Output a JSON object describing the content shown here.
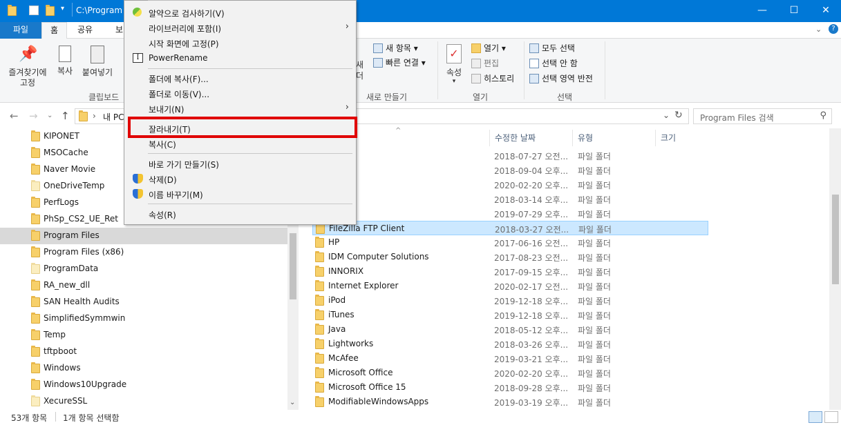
{
  "window": {
    "path": "C:\\Program"
  },
  "tabs": [
    "파일",
    "홈",
    "공유",
    "보"
  ],
  "ribbon": {
    "pin_label": "즐겨찾기에\n고정",
    "copy_label": "복사",
    "paste_label": "붙여넣기",
    "clipboard_group": "클립보드",
    "new_item": "새 항목",
    "easy_access": "빠른 연결",
    "new_group": "새로 만들기",
    "new_folder_partial": "새\n더",
    "properties": "속성",
    "open": "열기",
    "edit": "편집",
    "history": "히스토리",
    "open_group": "열기",
    "select_all": "모두 선택",
    "select_none": "선택 안 함",
    "invert_selection": "선택 영역 반전",
    "select_group": "선택"
  },
  "address": {
    "partial": "내 PC",
    "search_placeholder": "Program Files 검색"
  },
  "columns": {
    "modified": "수정한 날짜",
    "type": "유형",
    "size": "크기"
  },
  "nav_items": [
    "KIPONET",
    "MSOCache",
    "Naver Movie",
    "OneDriveTemp",
    "PerfLogs",
    "PhSp_CS2_UE_Ret",
    "Program Files",
    "Program Files (x86)",
    "ProgramData",
    "RA_new_dll",
    "SAN Health Audits",
    "SimplifiedSymmwin",
    "Temp",
    "tftpboot",
    "Windows",
    "Windows10Upgrade",
    "XecureSSL"
  ],
  "files": [
    {
      "name": "",
      "date": "2018-07-27 오전...",
      "type": "파일 폴더"
    },
    {
      "name": "",
      "date": "2018-09-04 오후...",
      "type": "파일 폴더"
    },
    {
      "name": "",
      "date": "2020-02-20 오후...",
      "type": "파일 폴더"
    },
    {
      "name": "",
      "date": "2018-03-14 오후...",
      "type": "파일 폴더"
    },
    {
      "name": "",
      "date": "2019-07-29 오후...",
      "type": "파일 폴더"
    },
    {
      "name": "FileZilla FTP Client",
      "date": "2018-03-27 오전...",
      "type": "파일 폴더"
    },
    {
      "name": "HP",
      "date": "2017-06-16 오전...",
      "type": "파일 폴더"
    },
    {
      "name": "IDM Computer Solutions",
      "date": "2017-08-23 오전...",
      "type": "파일 폴더"
    },
    {
      "name": "INNORIX",
      "date": "2017-09-15 오후...",
      "type": "파일 폴더"
    },
    {
      "name": "Internet Explorer",
      "date": "2020-02-17 오전...",
      "type": "파일 폴더"
    },
    {
      "name": "iPod",
      "date": "2019-12-18 오후...",
      "type": "파일 폴더"
    },
    {
      "name": "iTunes",
      "date": "2019-12-18 오후...",
      "type": "파일 폴더"
    },
    {
      "name": "Java",
      "date": "2018-05-12 오후...",
      "type": "파일 폴더"
    },
    {
      "name": "Lightworks",
      "date": "2018-03-26 오후...",
      "type": "파일 폴더"
    },
    {
      "name": "McAfee",
      "date": "2019-03-21 오후...",
      "type": "파일 폴더"
    },
    {
      "name": "Microsoft Office",
      "date": "2020-02-20 오후...",
      "type": "파일 폴더"
    },
    {
      "name": "Microsoft Office 15",
      "date": "2018-09-28 오후...",
      "type": "파일 폴더"
    },
    {
      "name": "ModifiableWindowsApps",
      "date": "2019-03-19 오후...",
      "type": "파일 폴더"
    }
  ],
  "context_menu": {
    "scan": "알약으로 검사하기(V)",
    "library": "라이브러리에 포함(I)",
    "pin_start": "시작 화면에 고정(P)",
    "powerrename": "PowerRename",
    "copy_to": "폴더에 복사(F)...",
    "move_to": "폴더로 이동(V)...",
    "send_to": "보내기(N)",
    "cut": "잘라내기(T)",
    "copy": "복사(C)",
    "shortcut": "바로 가기 만들기(S)",
    "delete": "삭제(D)",
    "rename": "이름 바꾸기(M)",
    "properties": "속성(R)"
  },
  "status": {
    "count": "53개 항목",
    "selected": "1개 항목 선택함"
  },
  "colors": {
    "titlebar": "#0078d7",
    "selection": "#cce8ff",
    "highlight_box": "#e00000"
  }
}
